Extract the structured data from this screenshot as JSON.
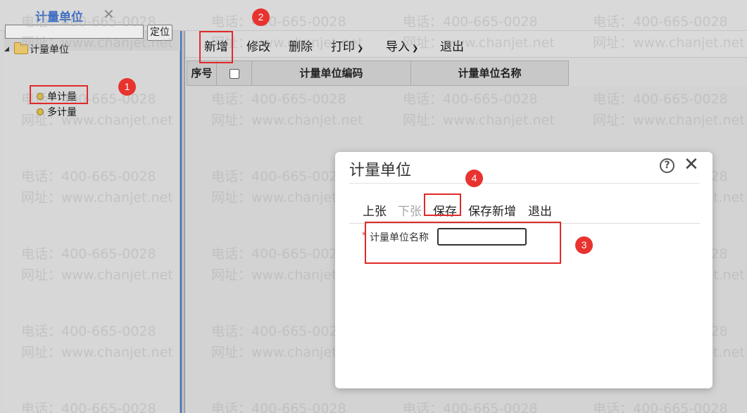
{
  "tab": {
    "label": "计量单位",
    "close": "✕"
  },
  "left": {
    "search_value": "",
    "locate_label": "定位",
    "tree_root": "计量单位",
    "tree_items": [
      "单计量",
      "多计量"
    ]
  },
  "toolbar": {
    "add": "新增",
    "edit": "修改",
    "delete": "删除",
    "print": "打印",
    "import": "导入",
    "exit": "退出"
  },
  "grid": {
    "col_index": "序号",
    "col_code": "计量单位编码",
    "col_name": "计量单位名称"
  },
  "dialog": {
    "title": "计量单位",
    "help": "?",
    "close": "✕",
    "prev": "上张",
    "next": "下张",
    "save": "保存",
    "save_new": "保存新增",
    "exit": "退出",
    "required_mark": "*",
    "field_label": "计量单位名称",
    "field_value": ""
  },
  "badges": [
    "1",
    "2",
    "3",
    "4"
  ],
  "watermark": {
    "phone": "电话：400-665-0028",
    "site": "网址：www.chanjet.net"
  },
  "colors": {
    "accent": "#3b6fc6",
    "highlight": "#e02a2a",
    "badge": "#e8332f"
  }
}
